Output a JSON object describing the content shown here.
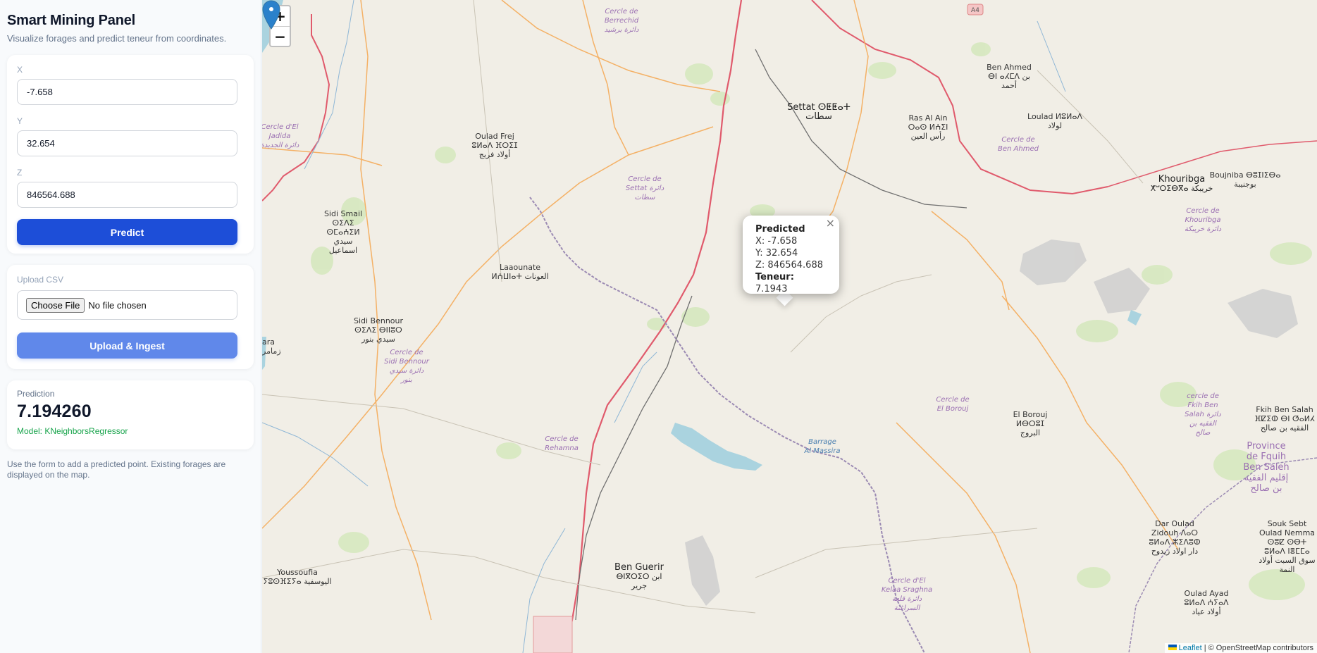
{
  "sidebar": {
    "title": "Smart Mining Panel",
    "subtitle": "Visualize forages and predict teneur from coordinates.",
    "form": {
      "x_label": "X",
      "x_value": "-7.658",
      "y_label": "Y",
      "y_value": "32.654",
      "z_label": "Z",
      "z_value": "846564.688",
      "predict_label": "Predict"
    },
    "upload": {
      "label": "Upload CSV",
      "choose_file": "Choose File",
      "no_file": "No file chosen",
      "button_label": "Upload & Ingest"
    },
    "prediction": {
      "label": "Prediction",
      "value": "7.194260",
      "model": "Model: KNeighborsRegressor"
    },
    "help_text": "Use the form to add a predicted point. Existing forages are displayed on the map."
  },
  "map": {
    "zoom_in": "+",
    "zoom_out": "−",
    "attribution_leaflet": "Leaflet",
    "attribution_rest": "| © OpenStreetMap contributors",
    "popup": {
      "title": "Predicted",
      "x": "X: -7.658",
      "y": "Y: 32.654",
      "z": "Z: 846564.688",
      "teneur_label": "Teneur:",
      "teneur_value": "7.1943",
      "close": "×"
    },
    "places": {
      "settat_1": "Settat ⵙⵟⵟⴰⵜ",
      "settat_2": "سطات",
      "khouribga_1": "Khouribga",
      "khouribga_2": "ⵅⵯⵔⵉⴱⴳⴰ خريبكة",
      "ben_guerir_1": "Ben Guerir",
      "ben_guerir_2": "ⴱⵏⴳⵔⵉⵔ ابن",
      "ben_guerir_3": "جرير",
      "laaounate": "Laaounate",
      "laaounate_2": "ⵍⵄⵡⵏⴰⵜ العونات",
      "oulad_frej": "Oulad Frej",
      "oulad_frej_2": "ⵓⵍⴰⴷ ⴼⵔⵉⵊ",
      "oulad_frej_3": "أولاد فريج",
      "sidi_smail": "Sidi Smail",
      "sidi_smail_2": "ⵙⵉⴷⵉ ⵙⵎⴰⵄⵉⵍ",
      "sidi_smail_3": "سيدي اسماعيل",
      "sidi_bennour": "Sidi Bennour",
      "sidi_bennour_2": "ⵙⵉⴷⵉ ⴱⵏⵏⵓⵔ",
      "sidi_bennour_3": "سيدي بنور",
      "ben_ahmed": "Ben Ahmed",
      "ben_ahmed_2": "ⴱⵏ ⴰⵃⵎⴷ بن",
      "ben_ahmed_3": "أحمد",
      "ras_al_ain": "Ras Al Ain",
      "ras_al_ain_2": "ⵔⴰⵙ ⵍⵄⵉⵏ",
      "ras_al_ain_3": "رأس العين",
      "loulad": "Loulad ⵍⵓⵍⴰⴷ",
      "loulad_2": "لولاد",
      "el_borouj": "El Borouj ⵍⴱⵔⵓⵊ",
      "el_borouj_2": "البروج",
      "youssoufia": "Youssoufia",
      "youssoufia_2": "ⵢⵓⵙⴼⵉⵢⴰ اليوسفية",
      "boujniba": "Boujniba ⴱⵓⵊⵏⵉⴱⴰ",
      "boujniba_2": "بوجنيبة",
      "fkih_ben_salah": "Fkih Ben Salah",
      "fkih_ben_salah_2": "ⴼⵇⵉⵀ ⴱⵏ ⵚⴰⵍⵃ",
      "fkih_ben_salah_3": "الفقيه بن صالح",
      "dar_oulad": "Dar Oulad",
      "dar_oulad_2": "Zidouh ⴷⴰⵔ",
      "dar_oulad_3": "ⵓⵍⴰⴷ ⵣⵉⴷⵓⵀ",
      "dar_oulad_4": "دار اولاد زيدوح",
      "souk_sebt": "Souk Sebt",
      "souk_sebt_2": "Oulad Nemma",
      "souk_sebt_3": "ⵙⵓⵇ ⵙⴱⵜ",
      "souk_sebt_4": "ⵓⵍⴰⴷ ⵏⴻⵎⵎⴰ",
      "souk_sebt_5": "سوق السبت أولاد",
      "souk_sebt_6": "النمة",
      "oulad_ayad": "Oulad Ayad",
      "oulad_ayad_2": "ⵓⵍⴰⴷ ⵄⵢⴰⴷ",
      "oulad_ayad_3": "أولاد عياد",
      "province_1": "Province",
      "province_2": "de Fquih",
      "province_3": "Ben Saleh",
      "province_4": "إقليم الفقيه",
      "province_5": "بن صالح",
      "cercle_berrechid_1": "Cercle de",
      "cercle_berrechid_2": "Berrechid",
      "cercle_berrechid_3": "دائرة برشيد",
      "cercle_eljadida_1": "Cercle d'El",
      "cercle_eljadida_2": "Jadida",
      "cercle_eljadida_3": "دائرة الجديدة",
      "cercle_settat_1": "Cercle de",
      "cercle_settat_2": "Settat دائرة",
      "cercle_settat_3": "سطات",
      "cercle_benahmed_1": "Cercle de",
      "cercle_benahmed_2": "Ben Ahmed",
      "cercle_khouribga_1": "Cercle de",
      "cercle_khouribga_2": "Khouribga",
      "cercle_khouribga_3": "دائرة خريبكة",
      "cercle_sidibennour_1": "Cercle de",
      "cercle_sidibennour_2": "Sidi Bennour",
      "cercle_sidibennour_3": "دائرة سيدي",
      "cercle_sidibennour_4": "بنور",
      "cercle_elbrouj_1": "Cercle de",
      "cercle_elbrouj_2": "El Borouj",
      "cercle_rehamna_1": "Cercle de",
      "cercle_rehamna_2": "Rehamna",
      "cercle_kelaa_1": "Cercle d'El",
      "cercle_kelaa_2": "Kelaa Sraghna",
      "cercle_kelaa_3": "دائرة قلعة",
      "cercle_kelaa_4": "السراغنة",
      "cercle_fkih_1": "cercle de",
      "cercle_fkih_2": "Fkih Ben",
      "cercle_fkih_3": "Salah دائرة",
      "cercle_fkih_4": "الفقيه بن",
      "cercle_fkih_5": "صالح",
      "barrage_1": "Barrage",
      "barrage_2": "Al Massira",
      "a4": "A4",
      "ara": "ara",
      "ara_2": "زمامر"
    }
  }
}
